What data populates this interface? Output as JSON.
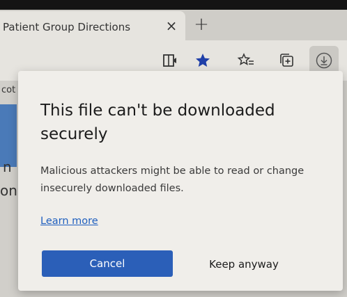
{
  "tab": {
    "title": "Patient Group Directions",
    "close_glyph": "×",
    "new_tab_glyph": "+"
  },
  "toolbar": {
    "icons": [
      "immersive-reader-icon",
      "favorite-star-icon",
      "favorites-list-icon",
      "collections-icon",
      "downloads-icon"
    ],
    "accent": "#1f3fa8"
  },
  "page": {
    "fragment_top": "cot",
    "fragment_mid": "n",
    "fragment_low": "on"
  },
  "dialog": {
    "title": "This file can't be downloaded securely",
    "body": "Malicious attackers might be able to read or change insecurely downloaded files.",
    "learn_more": "Learn more",
    "cancel_label": "Cancel",
    "keep_label": "Keep anyway",
    "primary_color": "#2b5fb8"
  }
}
